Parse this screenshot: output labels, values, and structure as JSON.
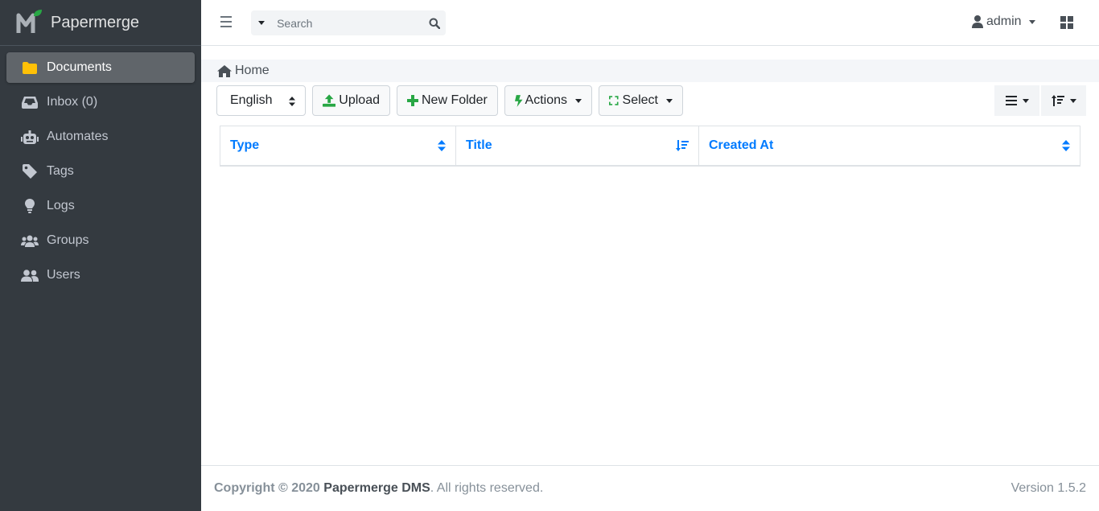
{
  "app": {
    "name": "Papermerge"
  },
  "sidebar": {
    "items": [
      {
        "label": "Documents",
        "icon": "folder-icon",
        "active": true
      },
      {
        "label": "Inbox (0)",
        "icon": "inbox-icon"
      },
      {
        "label": "Automates",
        "icon": "robot-icon"
      },
      {
        "label": "Tags",
        "icon": "tags-icon"
      },
      {
        "label": "Logs",
        "icon": "lightbulb-icon"
      },
      {
        "label": "Groups",
        "icon": "users-group-icon"
      },
      {
        "label": "Users",
        "icon": "users-icon"
      }
    ]
  },
  "topbar": {
    "search_placeholder": "Search",
    "user": "admin"
  },
  "breadcrumb": {
    "home": "Home"
  },
  "toolbar": {
    "language": "English",
    "upload": "Upload",
    "new_folder": "New Folder",
    "actions": "Actions",
    "select": "Select"
  },
  "table": {
    "columns": [
      "Type",
      "Title",
      "Created At"
    ]
  },
  "footer": {
    "copyright_prefix": "Copyright © 2020",
    "brand": "Papermerge DMS",
    "rights": ". All rights reserved.",
    "version_label": "Version",
    "version": "1.5.2"
  },
  "colors": {
    "sidebar_bg": "#343a40",
    "accent": "#007bff",
    "folder": "#ffc107",
    "success": "#28a745"
  }
}
